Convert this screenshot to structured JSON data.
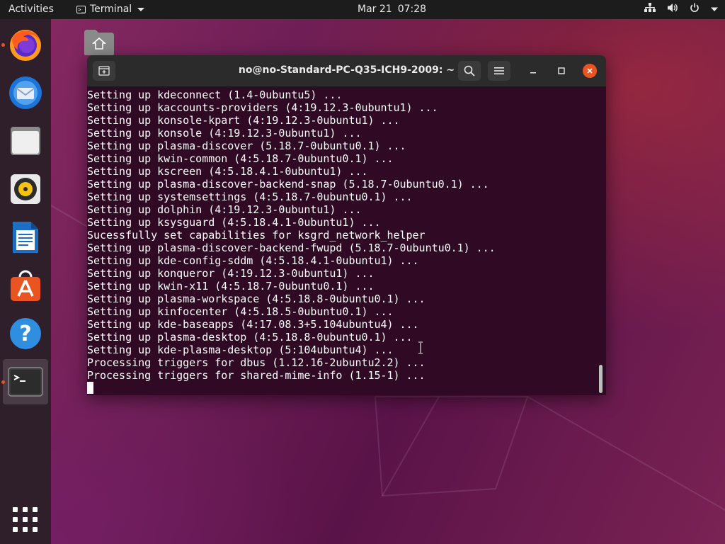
{
  "topbar": {
    "activities": "Activities",
    "app_name": "Terminal",
    "date": "Mar 21",
    "time": "07:28",
    "tray_icons": [
      "network-icon",
      "volume-icon",
      "power-icon",
      "chevron-down-icon"
    ]
  },
  "dock": {
    "items": [
      {
        "name": "Firefox",
        "icon": "firefox-icon",
        "running": true
      },
      {
        "name": "Thunderbird",
        "icon": "thunderbird-icon",
        "running": false
      },
      {
        "name": "Files",
        "icon": "files-icon",
        "running": false
      },
      {
        "name": "Rhythmbox",
        "icon": "rhythmbox-icon",
        "running": false
      },
      {
        "name": "LibreOffice Writer",
        "icon": "writer-icon",
        "running": false
      },
      {
        "name": "Ubuntu Software",
        "icon": "software-icon",
        "running": false
      },
      {
        "name": "Help",
        "icon": "help-icon",
        "running": false
      },
      {
        "name": "Terminal",
        "icon": "terminal-icon",
        "running": true
      }
    ],
    "show_apps_icon": "grid-icon"
  },
  "terminal": {
    "title": "no@no-Standard-PC-Q35-ICH9-2009: ~",
    "lines": [
      "Setting up kdeconnect (1.4-0ubuntu5) ...",
      "Setting up kaccounts-providers (4:19.12.3-0ubuntu1) ...",
      "Setting up konsole-kpart (4:19.12.3-0ubuntu1) ...",
      "Setting up konsole (4:19.12.3-0ubuntu1) ...",
      "Setting up plasma-discover (5.18.7-0ubuntu0.1) ...",
      "Setting up kwin-common (4:5.18.7-0ubuntu0.1) ...",
      "Setting up kscreen (4:5.18.4.1-0ubuntu1) ...",
      "Setting up plasma-discover-backend-snap (5.18.7-0ubuntu0.1) ...",
      "Setting up systemsettings (4:5.18.7-0ubuntu0.1) ...",
      "Setting up dolphin (4:19.12.3-0ubuntu1) ...",
      "Setting up ksysguard (4:5.18.4.1-0ubuntu1) ...",
      "Sucessfully set capabilities for ksgrd_network_helper",
      "Setting up plasma-discover-backend-fwupd (5.18.7-0ubuntu0.1) ...",
      "Setting up kde-config-sddm (4:5.18.4.1-0ubuntu1) ...",
      "Setting up konqueror (4:19.12.3-0ubuntu1) ...",
      "Setting up kwin-x11 (4:5.18.7-0ubuntu0.1) ...",
      "Setting up plasma-workspace (4:5.18.8-0ubuntu0.1) ...",
      "Setting up kinfocenter (4:5.18.5-0ubuntu0.1) ...",
      "Setting up kde-baseapps (4:17.08.3+5.104ubuntu4) ...",
      "Setting up plasma-desktop (4:5.18.8-0ubuntu0.1) ...",
      "Setting up kde-plasma-desktop (5:104ubuntu4) ...",
      "Processing triggers for dbus (1.12.16-2ubuntu2.2) ...",
      "Processing triggers for shared-mime-info (1.15-1) ..."
    ]
  },
  "colors": {
    "accent": "#e95420",
    "terminal_bg": "#300a24",
    "header_bg": "#2b2b2b",
    "topbar_bg": "#1c1c1c"
  }
}
